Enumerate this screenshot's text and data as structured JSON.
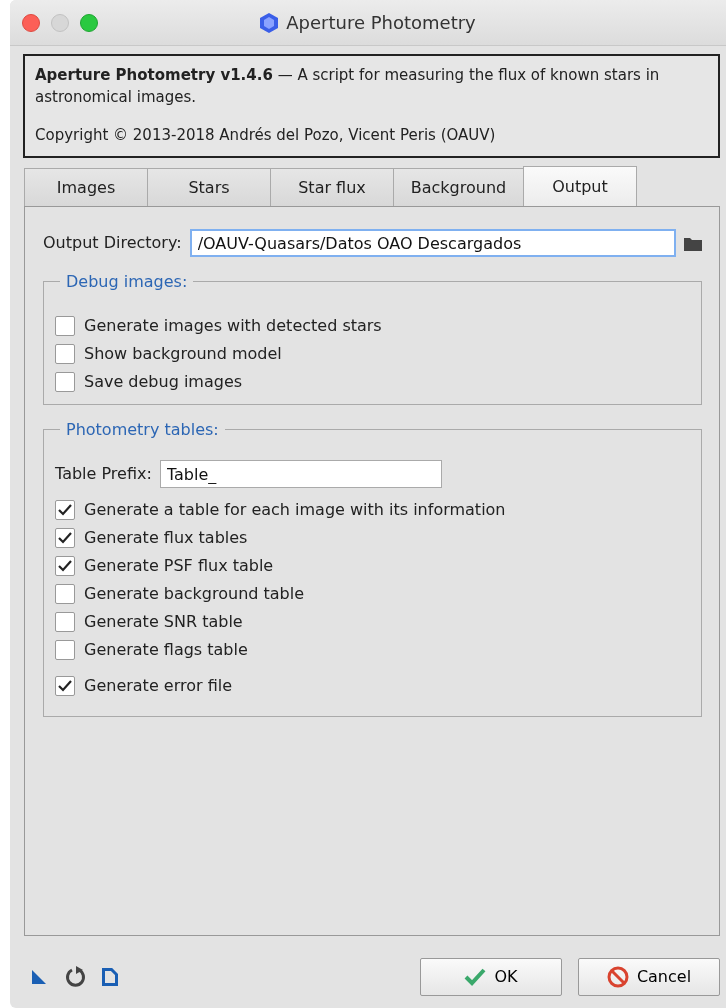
{
  "window": {
    "title": "Aperture Photometry"
  },
  "info": {
    "description": "**Aperture Photometry v1.4.6** — A script for measuring the flux of known stars in astronomical images.",
    "copyright": "Copyright © 2013-2018 Andrés del Pozo, Vicent Peris (OAUV)"
  },
  "tabs": [
    {
      "label": "Images",
      "selected": false
    },
    {
      "label": "Stars",
      "selected": false
    },
    {
      "label": "Star flux",
      "selected": false
    },
    {
      "label": "Background",
      "selected": false
    },
    {
      "label": "Output",
      "selected": true
    }
  ],
  "output_directory": {
    "label": "Output Directory:",
    "value": "/OAUV-Quasars/Datos OAO Descargados"
  },
  "debug_images": {
    "title": "Debug images:",
    "options": [
      {
        "label": "Generate images with detected stars",
        "checked": false
      },
      {
        "label": "Show background model",
        "checked": false
      },
      {
        "label": "Save debug images",
        "checked": false
      }
    ]
  },
  "photometry_tables": {
    "title": "Photometry tables:",
    "prefix_label": "Table Prefix:",
    "prefix_value": "Table_",
    "options": [
      {
        "label": "Generate a table for each image with its information",
        "checked": true
      },
      {
        "label": "Generate flux tables",
        "checked": true
      },
      {
        "label": "Generate PSF flux table",
        "checked": true
      },
      {
        "label": "Generate background table",
        "checked": false
      },
      {
        "label": "Generate SNR table",
        "checked": false
      },
      {
        "label": "Generate flags table",
        "checked": false
      }
    ],
    "error_option": {
      "label": "Generate error file",
      "checked": true
    }
  },
  "buttons": [
    {
      "kind": "ok",
      "label": "OK"
    },
    {
      "kind": "cancel",
      "label": "Cancel"
    }
  ]
}
